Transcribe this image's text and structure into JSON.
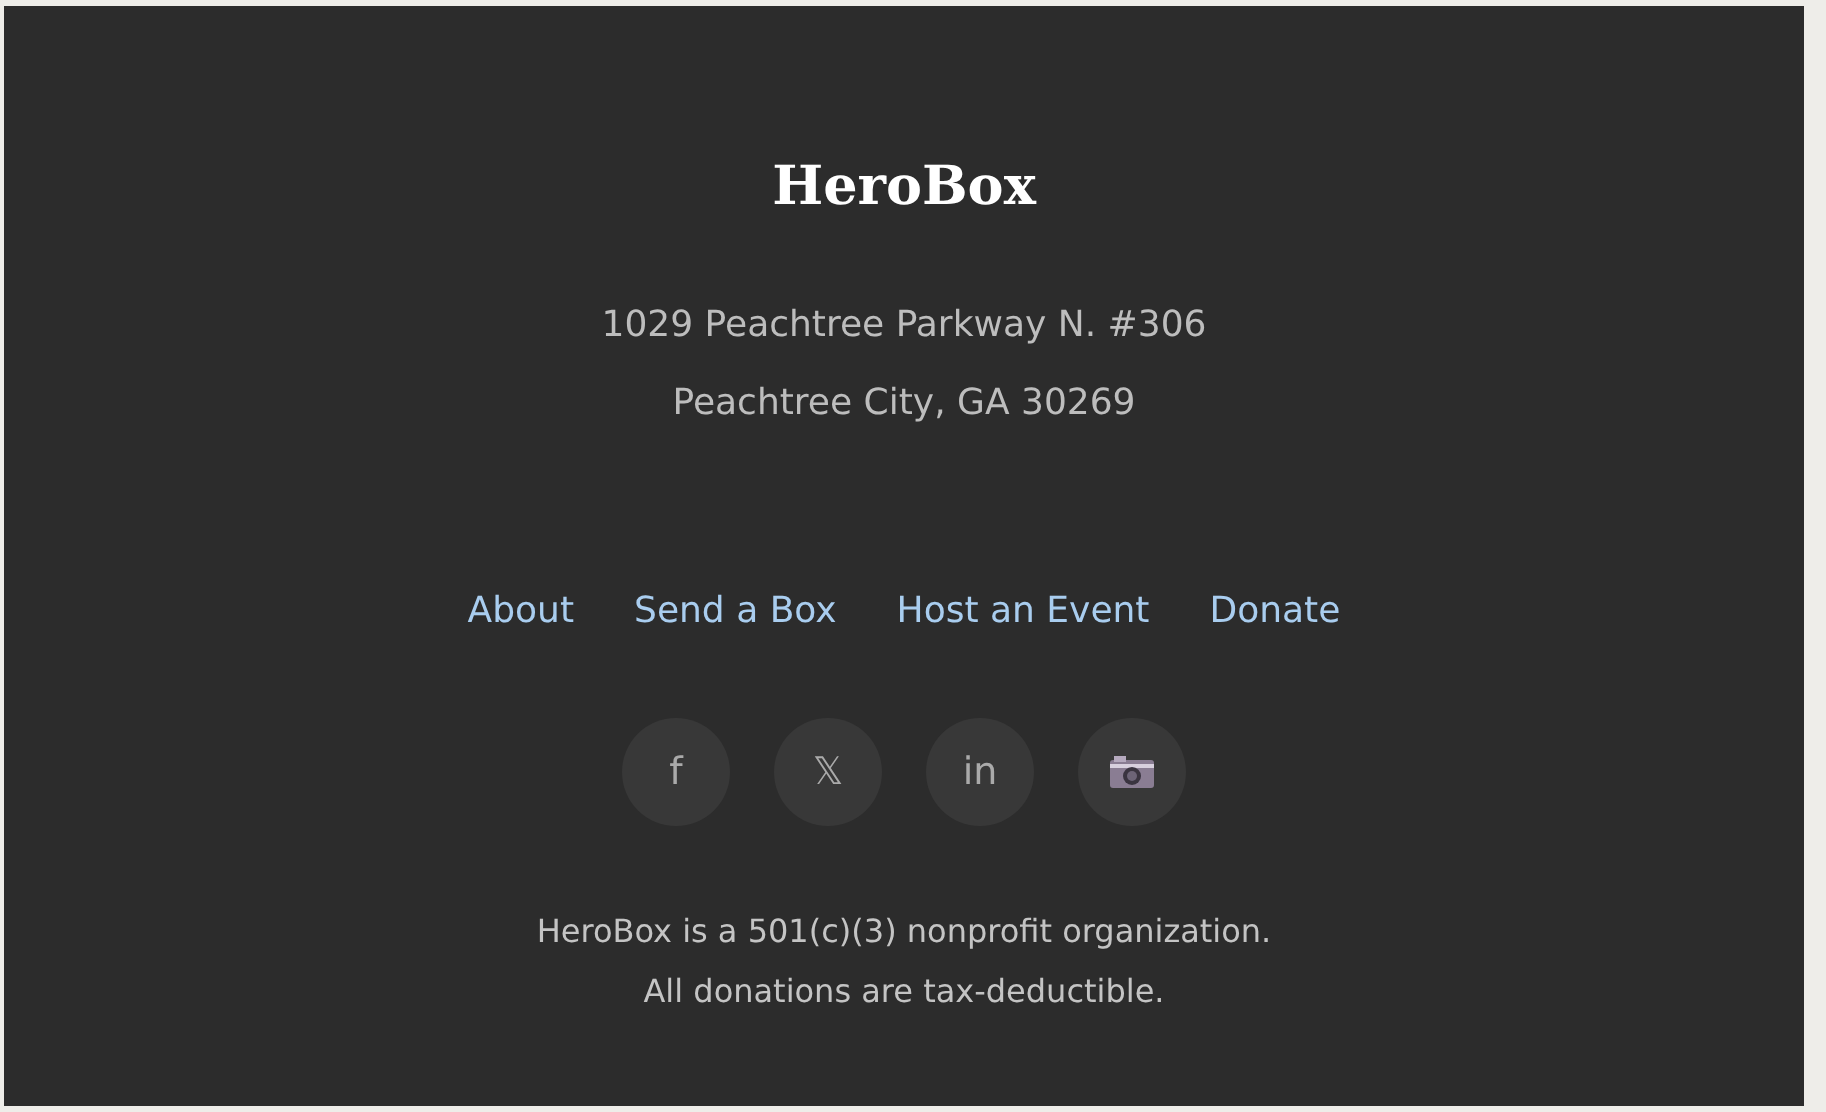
{
  "brand": "HeroBox",
  "address": [
    "1029 Peachtree Parkway N. #306",
    "Peachtree City, GA 30269"
  ],
  "links": [
    "About",
    "Send a Box",
    "Host an Event",
    "Donate"
  ],
  "social": [
    {
      "kind": "text",
      "glyph": "f"
    },
    {
      "kind": "text",
      "glyph": "𝕏"
    },
    {
      "kind": "text",
      "glyph": "in"
    },
    {
      "kind": "camera"
    }
  ],
  "note": [
    "HeroBox is a 501(c)(3) nonprofit organization.",
    "All donations are tax-deductible."
  ]
}
